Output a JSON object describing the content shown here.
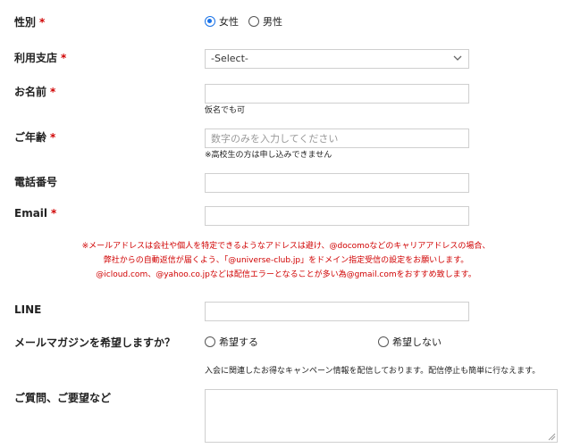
{
  "form": {
    "gender": {
      "label": "性別",
      "required_mark": "*",
      "options": [
        {
          "label": "女性",
          "selected": true
        },
        {
          "label": "男性",
          "selected": false
        }
      ]
    },
    "store": {
      "label": "利用支店",
      "required_mark": "*",
      "selected": "-Select-",
      "icon": "chevron-down-icon"
    },
    "name": {
      "label": "お名前",
      "required_mark": "*",
      "value": "",
      "hint": "仮名でも可"
    },
    "age": {
      "label": "ご年齢",
      "required_mark": "*",
      "placeholder": "数字のみを入力してください",
      "hint": "※高校生の方は申し込みできません"
    },
    "phone": {
      "label": "電話番号",
      "value": ""
    },
    "email": {
      "label": "Email",
      "required_mark": "*",
      "value": "",
      "notice": [
        "※メールアドレスは会社や個人を特定できるようなアドレスは避け、@docomoなどのキャリアアドレスの場合、",
        "弊社からの自動返信が届くよう、「@universe-club.jp」をドメイン指定受信の設定をお願いします。",
        "@icloud.com、@yahoo.co.jpなどは配信エラーとなることが多い為@gmail.comをおすすめ致します。"
      ],
      "notice_color": "#d00000"
    },
    "line": {
      "label": "LINE",
      "value": ""
    },
    "magazine": {
      "label": "メールマガジンを希望しますか？",
      "options": [
        {
          "label": "希望する",
          "selected": false
        },
        {
          "label": "希望しない",
          "selected": false
        }
      ],
      "hint": "入会に関連したお得なキャンペーン情報を配信しております。配信停止も簡単に行なえます。"
    },
    "questions": {
      "label": "ご質問、ご要望など",
      "value": ""
    }
  },
  "colors": {
    "required": "#d00000",
    "radio_selected": "#1a73e8"
  }
}
